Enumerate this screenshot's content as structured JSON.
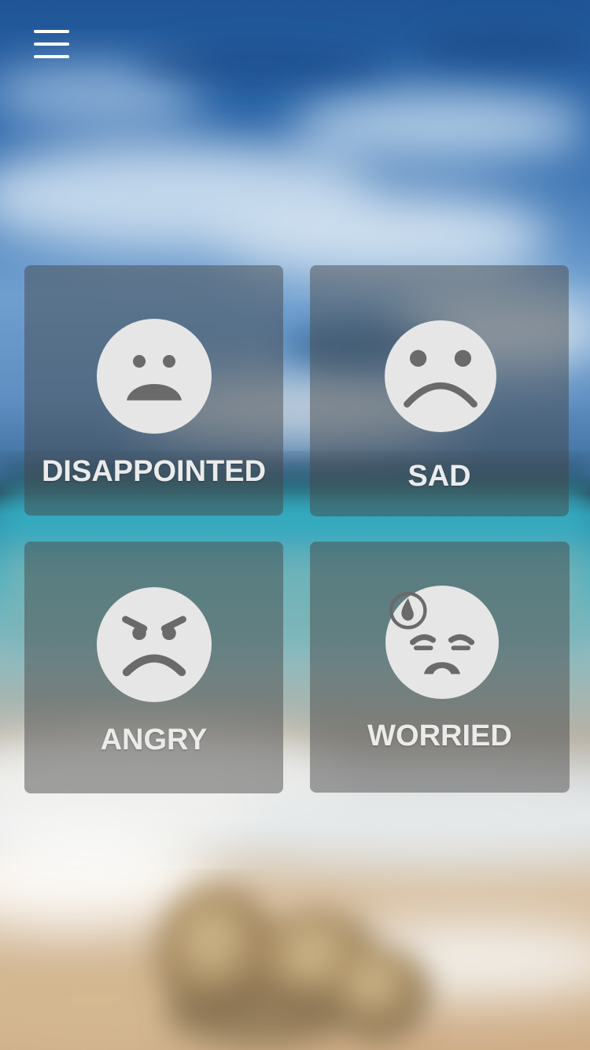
{
  "app": {
    "menu_icon": "hamburger-menu-icon"
  },
  "moods": [
    {
      "label": "DISAPPOINTED",
      "icon": "disappointed-face-icon"
    },
    {
      "label": "SAD",
      "icon": "sad-face-icon"
    },
    {
      "label": "ANGRY",
      "icon": "angry-face-icon"
    },
    {
      "label": "WORRIED",
      "icon": "worried-face-icon"
    }
  ],
  "colors": {
    "tile_overlay": "#464646",
    "face_fill": "#e6e6e6",
    "face_features": "#6a6a6a",
    "label_text": "#ebebeb"
  }
}
